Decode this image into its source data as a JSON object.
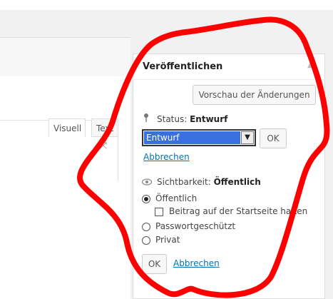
{
  "editor": {
    "tabs": [
      {
        "label": "Visuell"
      },
      {
        "label": "Text"
      }
    ],
    "icons": {
      "fullscreen": "fullscreen-expand-icon"
    }
  },
  "publish": {
    "title": "Veröffentlichen",
    "toggle_icon": "collapse-arrow-icon",
    "preview_button": "Vorschau der Änderungen",
    "status": {
      "label": "Status:",
      "value": "Entwurf",
      "icon": "pin-icon",
      "select_value": "Entwurf",
      "ok": "OK",
      "cancel": "Abbrechen"
    },
    "visibility": {
      "label": "Sichtbarkeit:",
      "value": "Öffentlich",
      "icon": "eye-icon",
      "options": [
        {
          "label": "Öffentlich",
          "checked": true
        },
        {
          "label": "Passwortgeschützt",
          "checked": false
        },
        {
          "label": "Privat",
          "checked": false
        }
      ],
      "sticky_label": "Beitrag auf der Startseite halten",
      "ok": "OK",
      "cancel": "Abbrechen"
    }
  },
  "annotation": {
    "color": "#ff0000"
  }
}
